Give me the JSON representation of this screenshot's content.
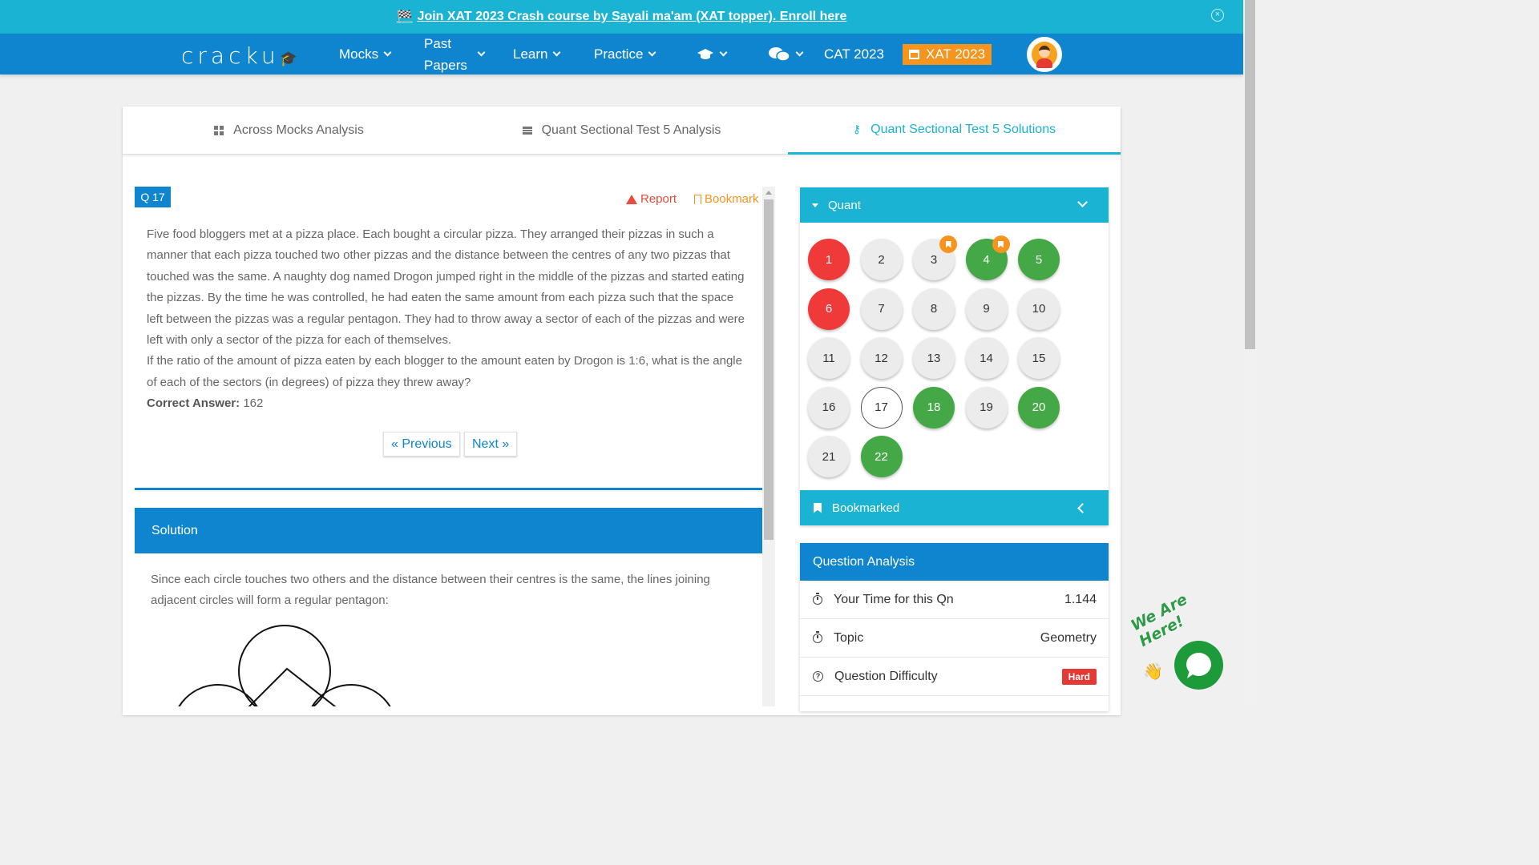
{
  "banner": {
    "flag_icon": "🏁",
    "link_text": "Join XAT 2023 Crash course by Sayali ma'am (XAT topper). Enroll here",
    "close_icon": "⊗"
  },
  "navbar": {
    "logo": "cracku",
    "items": {
      "mocks": "Mocks",
      "past_papers_1": "Past",
      "past_papers_2": "Papers",
      "learn": "Learn",
      "practice": "Practice",
      "cat": "CAT 2023",
      "xat": "XAT 2023"
    },
    "icons": [
      "graduation-cap-icon",
      "chat-icon"
    ]
  },
  "tabs": {
    "across": "Across Mocks Analysis",
    "analysis": "Quant Sectional Test 5 Analysis",
    "solutions": "Quant Sectional Test 5 Solutions"
  },
  "question": {
    "badge": "Q 17",
    "report": "Report",
    "bookmark": "Bookmark",
    "paragraph1": "Five food bloggers met at a pizza place. Each bought a circular pizza. They arranged their pizzas in such a manner that each pizza touched two other pizzas and the distance between the centres of any two pizzas that touched was the same. A naughty dog named Drogon jumped right in the middle of the pizzas and started eating the pizzas. By the time he was controlled, he had eaten the same amount from each pizza such that the space left between the pizzas was a regular pentagon. They had to throw away a sector of each of the pizzas and were left with only a sector of the pizza for each of themselves.",
    "paragraph2": "If the ratio of the amount of pizza eaten by each blogger to the amount eaten by Drogon is 1:6, what is the angle of each of the sectors (in degrees) of pizza they threw away?",
    "correct_label": "Correct Answer:",
    "correct_value": "162",
    "prev": "« Previous",
    "next": "Next »"
  },
  "solution": {
    "heading": "Solution",
    "text": "Since each circle touches two others and the distance between their centres is the same, the lines joining adjacent circles will form a regular pentagon:"
  },
  "palette": {
    "section": "Quant",
    "bookmarked": "Bookmarked",
    "questions": [
      {
        "n": "1",
        "status": "red",
        "flag": false
      },
      {
        "n": "2",
        "status": "grey",
        "flag": false
      },
      {
        "n": "3",
        "status": "grey",
        "flag": true
      },
      {
        "n": "4",
        "status": "green",
        "flag": true
      },
      {
        "n": "5",
        "status": "green",
        "flag": false
      },
      {
        "n": "6",
        "status": "red",
        "flag": false
      },
      {
        "n": "7",
        "status": "grey",
        "flag": false
      },
      {
        "n": "8",
        "status": "grey",
        "flag": false
      },
      {
        "n": "9",
        "status": "grey",
        "flag": false
      },
      {
        "n": "10",
        "status": "grey",
        "flag": false
      },
      {
        "n": "11",
        "status": "grey",
        "flag": false
      },
      {
        "n": "12",
        "status": "grey",
        "flag": false
      },
      {
        "n": "13",
        "status": "grey",
        "flag": false
      },
      {
        "n": "14",
        "status": "grey",
        "flag": false
      },
      {
        "n": "15",
        "status": "grey",
        "flag": false
      },
      {
        "n": "16",
        "status": "grey",
        "flag": false
      },
      {
        "n": "17",
        "status": "white",
        "flag": false
      },
      {
        "n": "18",
        "status": "green",
        "flag": false
      },
      {
        "n": "19",
        "status": "grey",
        "flag": false
      },
      {
        "n": "20",
        "status": "green",
        "flag": false
      },
      {
        "n": "21",
        "status": "grey",
        "flag": false
      },
      {
        "n": "22",
        "status": "green",
        "flag": false
      }
    ]
  },
  "analysis": {
    "heading": "Question Analysis",
    "rows": [
      {
        "label": "Your Time for this Qn",
        "value": "1.144"
      },
      {
        "label": "Topic",
        "value": "Geometry"
      },
      {
        "label": "Question Difficulty",
        "value": "Hard"
      }
    ]
  },
  "chat": {
    "label": "We Are Here!"
  },
  "colors": {
    "banner": "#1ab3d3",
    "navbar": "#0f85cf",
    "accent_orange": "#f7941d",
    "wrong": "#f03a3a",
    "correct": "#43a845",
    "difficulty_hard": "#e53935"
  }
}
